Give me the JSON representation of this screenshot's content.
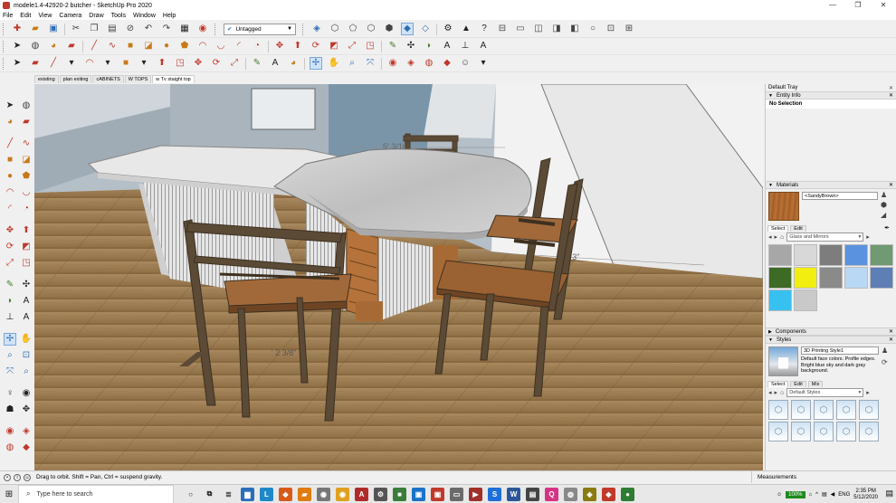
{
  "window": {
    "title": "modele1.4-42920-2 butcher - SketchUp Pro 2020",
    "min": "—",
    "restore": "❐",
    "close": "✕"
  },
  "menu": [
    "File",
    "Edit",
    "View",
    "Camera",
    "Draw",
    "Tools",
    "Window",
    "Help"
  ],
  "toolbar": {
    "tag_selected": "Untagged"
  },
  "scene_tabs": [
    {
      "label": "existing",
      "active": false
    },
    {
      "label": "plan exiting",
      "active": false
    },
    {
      "label": "cABINETS",
      "active": false
    },
    {
      "label": "W TOPS",
      "active": false
    },
    {
      "label": "w Tv staight top",
      "active": true
    }
  ],
  "viewport": {
    "dims": {
      "top": "5' 3/16\"",
      "right": "5' 3\"",
      "floor": "' 2 3/8\""
    }
  },
  "tray": {
    "title": "Default Tray",
    "entity_info": {
      "header": "Entity Info",
      "value": "No Selection"
    },
    "materials": {
      "header": "Materials",
      "name": "<SandyBrown>",
      "tabs": [
        "Select",
        "Edit"
      ],
      "collection": "Glass and Mirrors",
      "swatches": [
        "#a7a7a7",
        "#d8d8d8",
        "#7d7d7d",
        "#5b92e0",
        "#6f9a72",
        "#3d6a25",
        "#f2ee10",
        "#8a8a8a",
        "#b8d8f4",
        "#5d7fb5",
        "#37c1f0",
        "#c9c9c9"
      ]
    },
    "components": {
      "header": "Components"
    },
    "styles": {
      "header": "Styles",
      "name": "3D Printing Style1",
      "description": "Default face colors. Profile edges. Bright blue sky and dark gray background.",
      "tabs": [
        "Select",
        "Edit",
        "Mix"
      ],
      "collection": "Default Styles"
    }
  },
  "statusbar": {
    "message": "Drag to orbit. Shift = Pan, Ctrl = suspend gravity.",
    "measurements_label": "Measurements"
  },
  "taskbar": {
    "search_placeholder": "Type here to search",
    "battery": "100%",
    "language": "ENG",
    "time": "2:35 PM",
    "date": "5/12/2020"
  }
}
